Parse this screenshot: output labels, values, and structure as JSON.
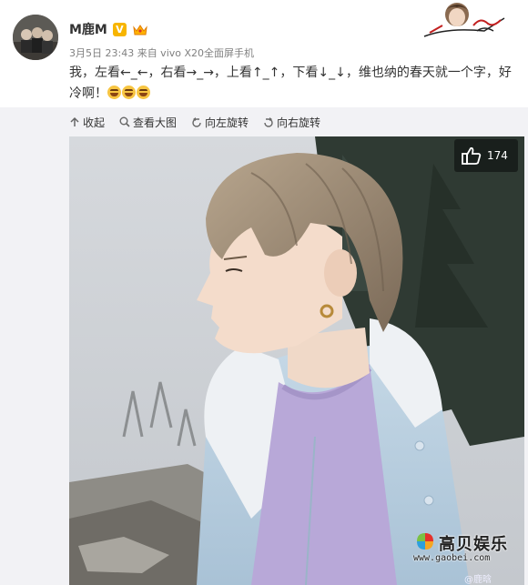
{
  "post": {
    "username": "M鹿M",
    "verified_mark": "V",
    "meta": "3月5日 23:43 来自 vivo X20全面屏手机",
    "text": "我，左看←_←，右看→_→，上看↑_↑，下看↓_↓，维也纳的春天就一个字，好冷啊！",
    "emoji_count": 3
  },
  "toolbar": {
    "collapse": "收起",
    "view_large": "查看大图",
    "rotate_left": "向左旋转",
    "rotate_right": "向右旋转"
  },
  "photo": {
    "like_count": "174"
  },
  "watermark": {
    "title": "高贝娱乐",
    "url": "www.gaobei.com",
    "corner": "@鹿晗"
  },
  "colors": {
    "verified": "#f7b500",
    "meta_text": "#808080",
    "media_bg": "#f2f2f5"
  },
  "icons": [
    "crown-icon",
    "collapse-icon",
    "zoom-icon",
    "rotate-left-icon",
    "rotate-right-icon",
    "thumbs-up-icon",
    "laugh-emoji-icon"
  ]
}
